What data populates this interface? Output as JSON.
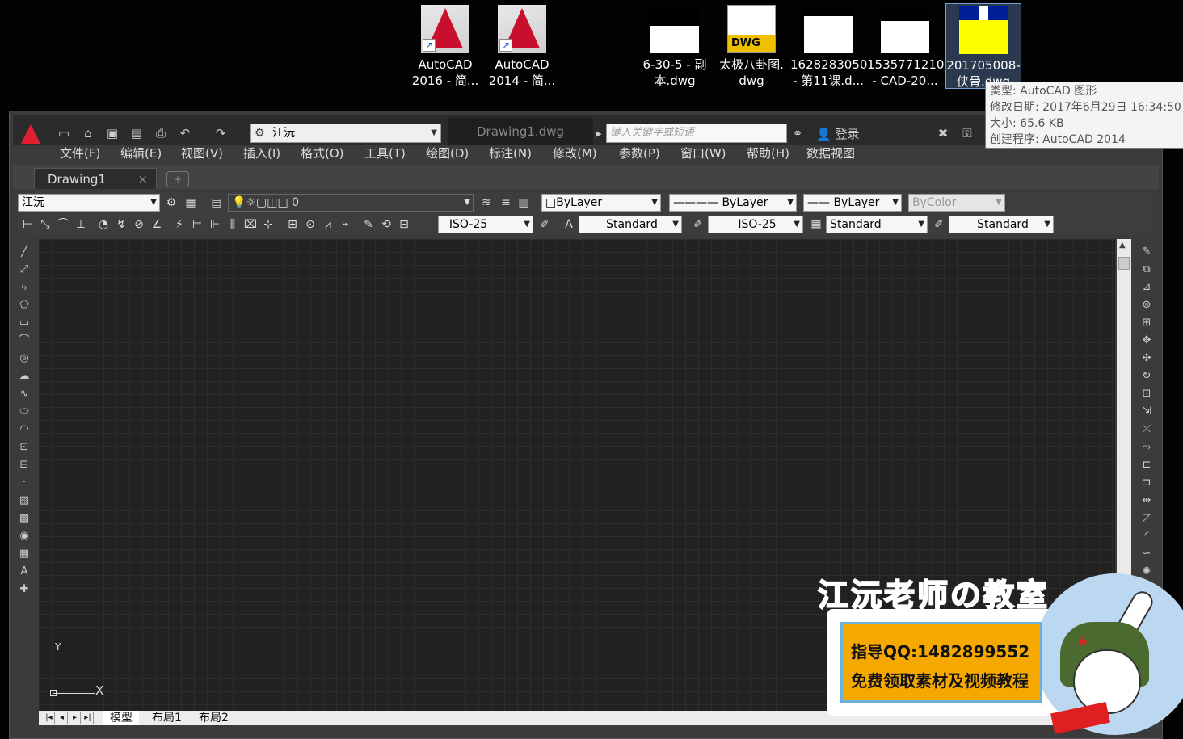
{
  "desktop": {
    "icons": [
      {
        "label": "AutoCAD\n2016 - 简...",
        "line1": "AutoCAD",
        "line2": "2016 - 简..."
      },
      {
        "label": "AutoCAD 2014",
        "line1": "AutoCAD",
        "line2": "2014 - 简..."
      },
      {
        "line1": "6-30-5 - 副",
        "line2": "本.dwg"
      },
      {
        "line1": "太极八卦图.",
        "line2": "dwg",
        "badge": "DWG"
      },
      {
        "line1": "1628283050",
        "line2": "- 第11课.d..."
      },
      {
        "line1": "1535771210",
        "line2": "- CAD-20..."
      },
      {
        "line1": "201705008-",
        "line2": "侠骨.dwg"
      }
    ]
  },
  "tooltip": {
    "type": "类型: AutoCAD 图形",
    "modified": "修改日期: 2017年6月29日 16:34:50",
    "size": "大小: 65.6 KB",
    "creator": "创建程序: AutoCAD 2014"
  },
  "titlebar": {
    "workspace": "江沅",
    "doc_title": "Drawing1.dwg",
    "search_placeholder": "键入关键字或短语",
    "login": "登录"
  },
  "menu": [
    "文件(F)",
    "编辑(E)",
    "视图(V)",
    "插入(I)",
    "格式(O)",
    "工具(T)",
    "绘图(D)",
    "标注(N)",
    "修改(M)",
    "参数(P)",
    "窗口(W)",
    "帮助(H)",
    "数据视图"
  ],
  "doc_tab": "Drawing1",
  "toolbar1": {
    "workspace": "江沅",
    "layer": "0",
    "color": "ByLayer",
    "linetype": "ByLayer",
    "lineweight": "ByLayer",
    "plotstyle": "ByColor"
  },
  "toolbar2": {
    "dimstyle": "ISO-25",
    "textstyle": "Standard",
    "dimstyle2": "ISO-25",
    "tablestyle": "Standard",
    "mleaderstyle": "Standard"
  },
  "ucs": {
    "x": "X",
    "y": "Y"
  },
  "layout_tabs": [
    "模型",
    "布局1",
    "布局2"
  ],
  "promo": {
    "title": "江沅老师の教室",
    "line1": "指导QQ:1482899552",
    "line2": "免费领取素材及视频教程"
  },
  "colors": {
    "canvas": "#212121",
    "accent": "#e02030",
    "promo_orange": "#f5a800"
  }
}
